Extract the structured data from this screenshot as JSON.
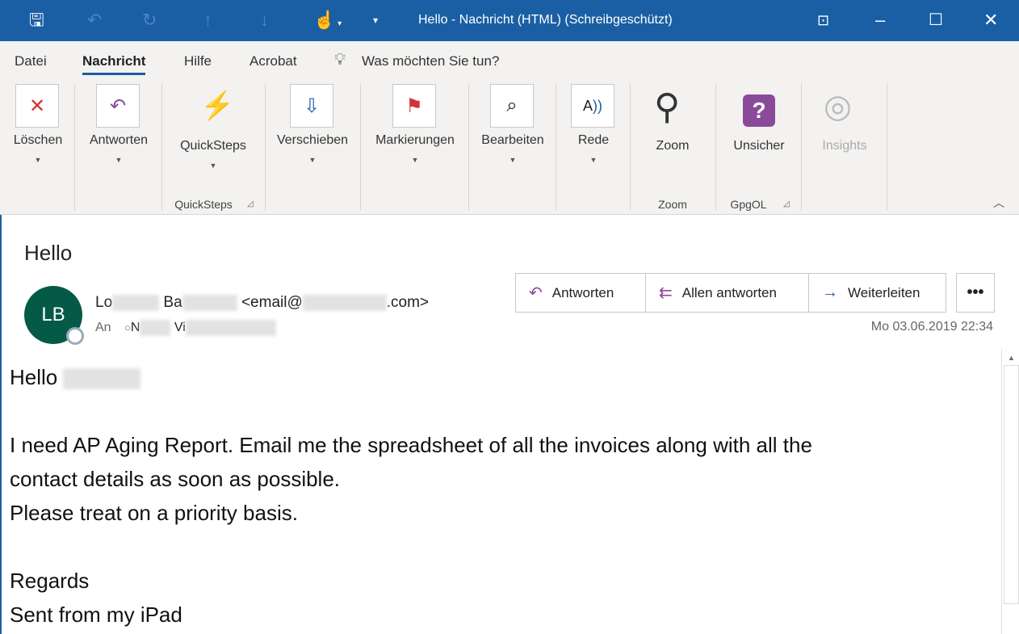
{
  "window": {
    "title": "Hello  -  Nachricht (HTML) (Schreibgeschützt)"
  },
  "qat": [
    "save-icon",
    "undo-icon",
    "redo-icon",
    "up-icon",
    "down-icon",
    "touch-mode-icon",
    "customize-icon"
  ],
  "tabs": [
    {
      "label": "Datei"
    },
    {
      "label": "Nachricht"
    },
    {
      "label": "Hilfe"
    },
    {
      "label": "Acrobat"
    }
  ],
  "search": {
    "placeholder": "Was möchten Sie tun?"
  },
  "ribbon": {
    "buttons": [
      {
        "label": "Löschen"
      },
      {
        "label": "Antworten"
      },
      {
        "label": "QuickSteps"
      },
      {
        "label": "Verschieben"
      },
      {
        "label": "Markierungen"
      },
      {
        "label": "Bearbeiten"
      },
      {
        "label": "Rede"
      },
      {
        "label": "Zoom"
      },
      {
        "label": "Unsicher"
      },
      {
        "label": "Insights"
      }
    ],
    "groups": [
      {
        "label": "QuickSteps"
      },
      {
        "label": "Zoom"
      },
      {
        "label": "GpgOL"
      }
    ]
  },
  "message": {
    "subject": "Hello",
    "avatar_initials": "LB",
    "sender_first": "Lo",
    "sender_last": "Ba",
    "email_prefix": "<email@",
    "email_suffix": ".com>",
    "to_label": "An",
    "recipient_first": "N",
    "recipient_last": "Vi",
    "date": "Mo 03.06.2019 22:34",
    "actions": {
      "reply": "Antworten",
      "reply_all": "Allen antworten",
      "forward": "Weiterleiten",
      "more": "•••"
    },
    "body": {
      "greeting": "Hello",
      "line1": "I need AP Aging Report. Email me the spreadsheet of all the invoices along with all the",
      "line2": "contact details as soon as possible.",
      "line3": "Please treat on a priority basis.",
      "closing": "Regards",
      "signature": "Sent from my iPad"
    }
  }
}
